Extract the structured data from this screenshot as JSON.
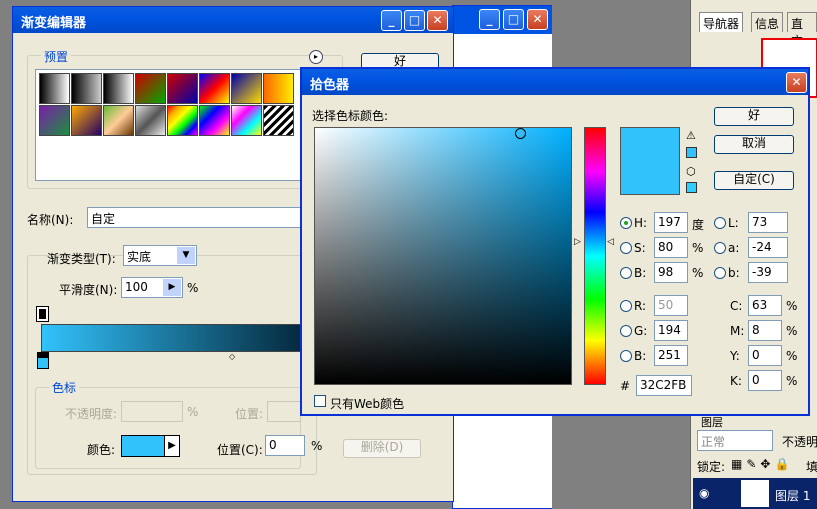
{
  "gradient_editor": {
    "title": "渐变编辑器",
    "presets_label": "预置",
    "ok_label": "好",
    "name_label": "名称(N):",
    "name_value": "自定",
    "type_label": "渐变类型(T):",
    "type_value": "实底",
    "smooth_label": "平滑度(N):",
    "smooth_value": "100",
    "percent": "%",
    "stops_label": "色标",
    "opacity_label": "不透明度:",
    "location_label": "位置:",
    "color_label": "颜色:",
    "location_c_label": "位置(C):",
    "location_c_value": "0",
    "delete_label": "删除(D)"
  },
  "color_picker": {
    "title": "拾色器",
    "prompt": "选择色标颜色:",
    "ok_label": "好",
    "cancel_label": "取消",
    "custom_label": "自定(C)",
    "web_only_label": "只有Web颜色",
    "current_color": "#32C2FB",
    "hex_prefix": "#",
    "hex_value": "32C2FB",
    "hsb": [
      {
        "label": "H:",
        "value": "197",
        "unit": "度",
        "selected": true
      },
      {
        "label": "S:",
        "value": "80",
        "unit": "%",
        "selected": false
      },
      {
        "label": "B:",
        "value": "98",
        "unit": "%",
        "selected": false
      }
    ],
    "rgb": [
      {
        "label": "R:",
        "value": "50"
      },
      {
        "label": "G:",
        "value": "194"
      },
      {
        "label": "B:",
        "value": "251"
      }
    ],
    "lab": [
      {
        "label": "L:",
        "value": "73"
      },
      {
        "label": "a:",
        "value": "-24"
      },
      {
        "label": "b:",
        "value": "-39"
      }
    ],
    "cmyk": [
      {
        "label": "C:",
        "value": "63",
        "unit": "%"
      },
      {
        "label": "M:",
        "value": "8",
        "unit": "%"
      },
      {
        "label": "Y:",
        "value": "0",
        "unit": "%"
      },
      {
        "label": "K:",
        "value": "0",
        "unit": "%"
      }
    ]
  },
  "right_panel": {
    "tab_navigator": "导航器",
    "tab_info": "信息",
    "tab_histogram": "直方",
    "layers_tabs": "图层",
    "blend_mode": "正常",
    "opacity_label": "不透明",
    "lock_label": "锁定:",
    "fill_label": "填",
    "layer_name": "图层 1"
  },
  "colors": {
    "titlebar": "#0054e3",
    "dialog_bg": "#ece9d8",
    "accent": "#32c2fb"
  }
}
